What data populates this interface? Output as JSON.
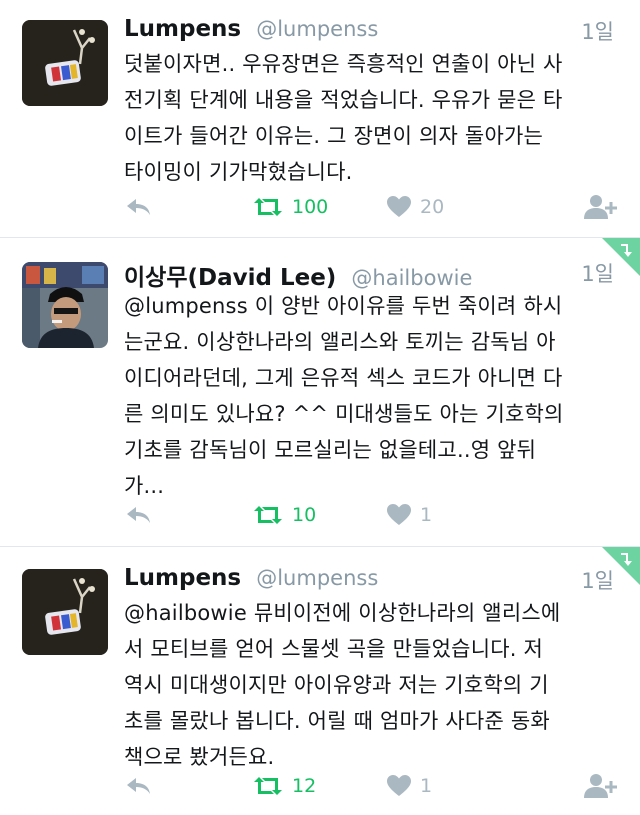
{
  "tweets": [
    {
      "name": "Lumpens",
      "handle": "@lumpenss",
      "time": "1일",
      "lines": [
        "덧붙이자면.. 우유장면은 즉흥적인 연출이 아닌 사",
        "전기획 단계에 내용을 적었습니다. 우유가 묻은 타",
        "이트가 들어간 이유는. 그 장면이 의자 돌아가는",
        "타이밍이 기가막혔습니다."
      ],
      "retweets": "100",
      "likes": "20"
    },
    {
      "name": "이상무(David Lee)",
      "handle": "@hailbowie",
      "time": "1일",
      "lines": [
        "@lumpenss 이 양반 아이유를 두번 죽이려 하시",
        "는군요. 이상한나라의 앨리스와 토끼는 감독님 아",
        "이디어라던데, 그게 은유적 섹스 코드가 아니면 다",
        "른 의미도 있나요? ^^ 미대생들도 아는 기호학의",
        "기초를 감독님이 모르실리는 없을테고..영 앞뒤",
        "가..."
      ],
      "retweets": "10",
      "likes": "1"
    },
    {
      "name": "Lumpens",
      "handle": "@lumpenss",
      "time": "1일",
      "lines": [
        "@hailbowie 뮤비이전에 이상한나라의 앨리스에",
        "서 모티브를 얻어 스물셋 곡을 만들었습니다.   저",
        "역시 미대생이지만 아이유양과 저는 기호학의 기",
        "초를 몰랐나 봅니다.  어릴 때 엄마가 사다준 동화",
        "책으로 봤거든요."
      ],
      "retweets": "12",
      "likes": "1"
    }
  ],
  "icons": {
    "reply": "reply-icon",
    "retweet": "retweet-icon",
    "like": "heart-icon",
    "follow": "follow-icon",
    "corner": "conversation-corner-icon"
  },
  "colors": {
    "retweet_green": "#17bf63",
    "corner_green": "#6dd3a0",
    "muted_gray": "#aab8c2",
    "handle_gray": "#8899a6"
  }
}
